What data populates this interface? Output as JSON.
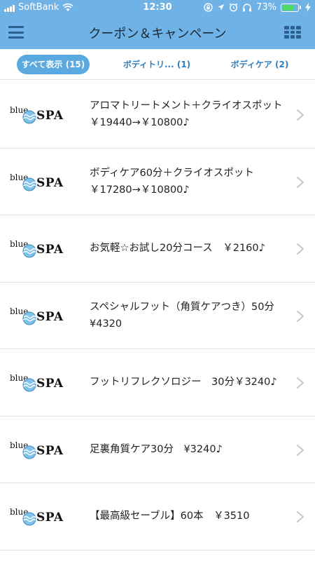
{
  "status_bar": {
    "carrier": "SoftBank",
    "time": "12:30",
    "battery_percent": "73%",
    "battery_level": 0.73,
    "icons": [
      "signal-icon",
      "wifi-icon",
      "rotation-lock-icon",
      "location-icon",
      "alarm-icon",
      "headphones-icon",
      "battery-icon",
      "charging-icon"
    ]
  },
  "header": {
    "title": "クーポン＆キャンペーン",
    "menu_icon": "hamburger-menu-icon",
    "grid_icon": "grid-icon"
  },
  "tabs": [
    {
      "label": "すべて表示 (15)",
      "active": true
    },
    {
      "label": "ボディトリ... (1)",
      "active": false
    },
    {
      "label": "ボディケア (2)",
      "active": false
    }
  ],
  "logo": {
    "word1": "blue",
    "word2": "SPA"
  },
  "coupons": [
    {
      "text": "アロマトリートメント＋クライオスポット￥19440→￥10800♪"
    },
    {
      "text": "ボディケア60分＋クライオスポット￥17280→￥10800♪"
    },
    {
      "text": "お気軽☆お試し20分コース　￥2160♪"
    },
    {
      "text": "スペシャルフット（角質ケアつき）50分　¥4320"
    },
    {
      "text": "フットリフレクソロジー　30分￥3240♪"
    },
    {
      "text": "足裏角質ケア30分　¥3240♪"
    },
    {
      "text": "【最高級セーブル】60本　￥3510"
    }
  ],
  "colors": {
    "header_bg": "#6fb2e5",
    "icon_dark": "#2a5f8f",
    "tab_active_bg": "#5aa9e0",
    "tab_text": "#2f7dbd",
    "battery_fill": "#4cd964"
  }
}
